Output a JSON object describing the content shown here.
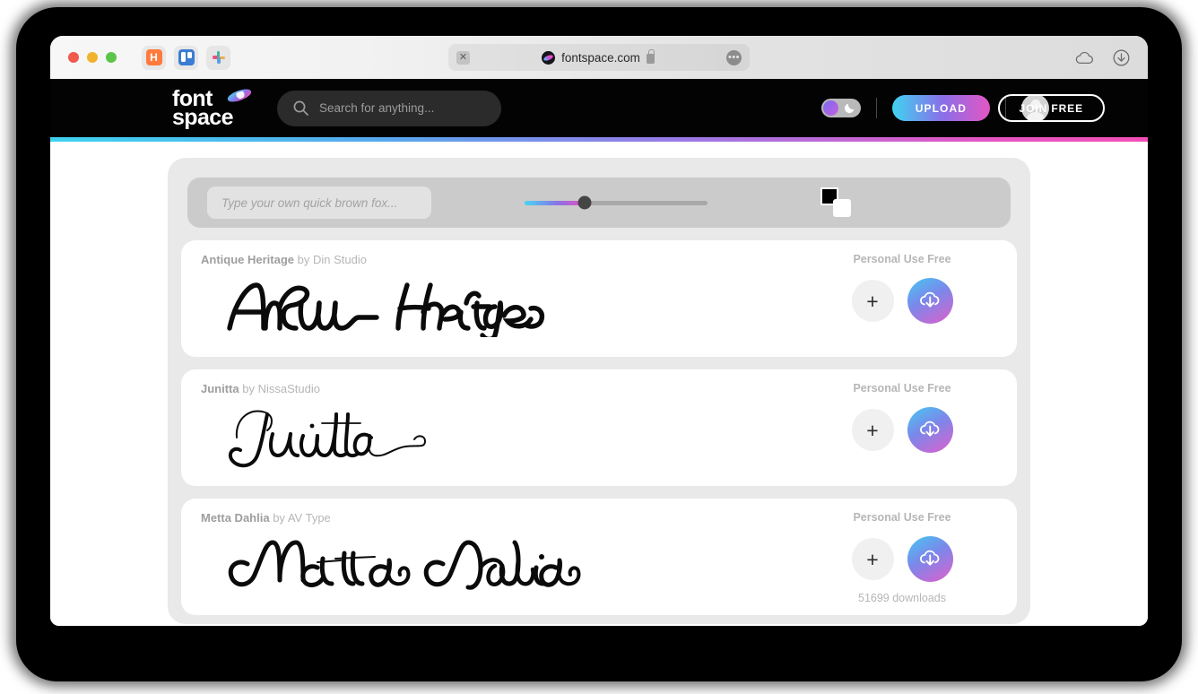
{
  "browser": {
    "traffic_lights": [
      "close",
      "minimize",
      "zoom"
    ],
    "pinned_tabs": [
      {
        "name": "hubspot-tab",
        "glyph": "H"
      },
      {
        "name": "trello-tab",
        "glyph": ""
      },
      {
        "name": "slack-tab",
        "glyph": ""
      }
    ],
    "address": {
      "close_glyph": "✕",
      "url": "fontspace.com",
      "lock_icon": "lock-icon",
      "menu_glyph": "•••"
    },
    "toolbar_right": [
      "cloud-icon",
      "downloads-icon"
    ]
  },
  "header": {
    "logo_line1": "font",
    "logo_line2": "space",
    "logo_icon": "planet-icon",
    "search": {
      "placeholder": "Search for anything...",
      "value": "",
      "icon": "search-icon"
    },
    "theme_toggle": {
      "state": "light",
      "icon": "moon-icon"
    },
    "upload_label": "UPLOAD",
    "join_label": "JOIN FREE",
    "avatar_icon": "user-avatar-icon",
    "accent_gradient": [
      "#3fd3f0",
      "#9b78e6",
      "#f24fb6"
    ]
  },
  "controls": {
    "preview_placeholder": "Type your own quick brown fox...",
    "preview_value": "",
    "size_slider": {
      "value": 33,
      "min": 0,
      "max": 100
    },
    "color_swatches": {
      "foreground": "#000000",
      "background": "#ffffff"
    }
  },
  "fonts": [
    {
      "name": "Antique Heritage",
      "by_label": "by",
      "author": "Din Studio",
      "license": "Personal Use Free",
      "sample_text": "Antique Heritage",
      "downloads": "",
      "add_glyph": "+",
      "download_icon": "cloud-download-icon"
    },
    {
      "name": "Junitta",
      "by_label": "by",
      "author": "NissaStudio",
      "license": "Personal Use Free",
      "sample_text": "Junitta",
      "downloads": "",
      "add_glyph": "+",
      "download_icon": "cloud-download-icon"
    },
    {
      "name": "Metta Dahlia",
      "by_label": "by",
      "author": "AV Type",
      "license": "Personal Use Free",
      "sample_text": "Metta Dahlia",
      "downloads": "51699 downloads",
      "add_glyph": "+",
      "download_icon": "cloud-download-icon"
    }
  ]
}
